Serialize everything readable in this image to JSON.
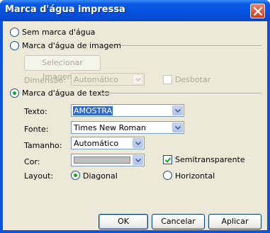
{
  "window": {
    "title": "Marca d'água impressa"
  },
  "options": {
    "no_watermark": "Sem marca d'água",
    "image_watermark": "Marca d'água de imagem",
    "text_watermark": "Marca d'água de texto"
  },
  "image_section": {
    "select_image_button": "Selecionar Imagem...",
    "scale_label": "Dimensão:",
    "scale_value": "Automático",
    "washout_label": "Desbotar"
  },
  "text_section": {
    "text_label": "Texto:",
    "text_value": "AMOSTRA",
    "font_label": "Fonte:",
    "font_value": "Times New Roman",
    "size_label": "Tamanho:",
    "size_value": "Automático",
    "color_label": "Cor:",
    "color_value": "#c0c0c0",
    "semitransparent_label": "Semitransparente",
    "layout_label": "Layout:",
    "layout_diagonal": "Diagonal",
    "layout_horizontal": "Horizontal"
  },
  "state": {
    "selected_option": "text_watermark",
    "semitransparent_checked": true,
    "washout_checked": false,
    "layout_selected": "diagonal"
  },
  "buttons": {
    "ok": "OK",
    "cancel": "Cancelar",
    "apply": "Aplicar"
  }
}
